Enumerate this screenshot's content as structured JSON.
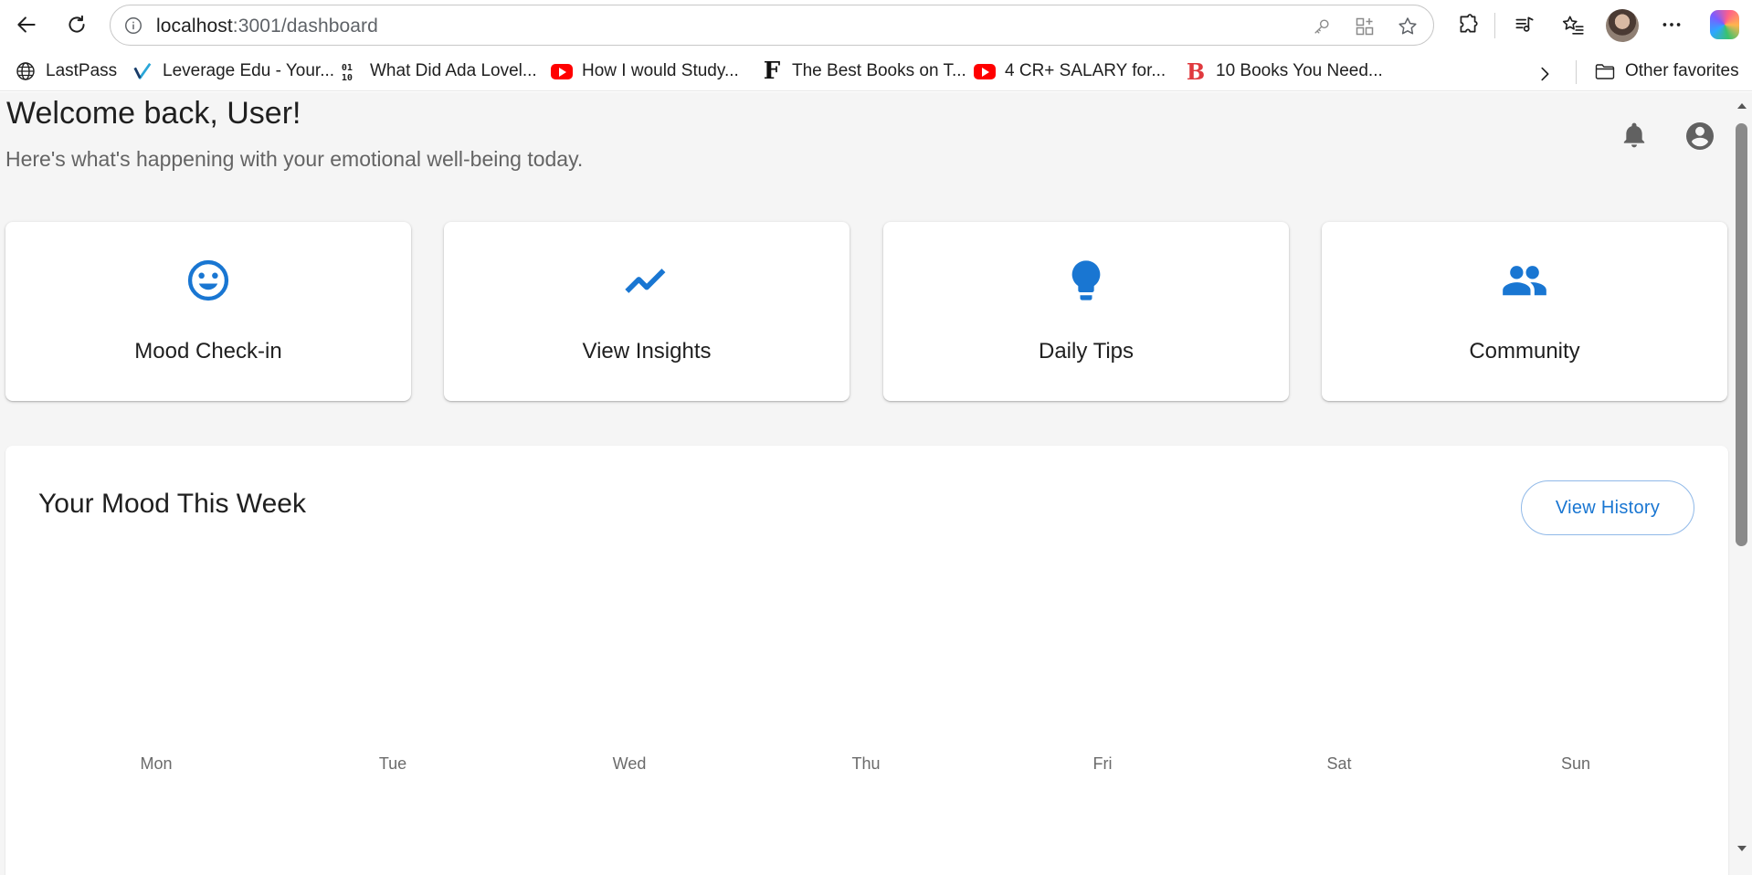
{
  "browser": {
    "url_host": "localhost",
    "url_path": ":3001/dashboard",
    "bookmarks": [
      {
        "label": "LastPass",
        "icon": "globe-icon"
      },
      {
        "label": "Leverage Edu - Your...",
        "icon": "leverage-edu-icon"
      },
      {
        "label": "What Did Ada Lovel...",
        "icon": "ada-icon"
      },
      {
        "label": "How I would Study...",
        "icon": "youtube-icon"
      },
      {
        "label": "The Best Books on T...",
        "icon": "f-letter-icon"
      },
      {
        "label": "4 CR+ SALARY for...",
        "icon": "youtube-icon"
      },
      {
        "label": "10 Books You Need...",
        "icon": "b-letter-icon"
      }
    ],
    "other_favorites": "Other favorites"
  },
  "page": {
    "welcome": "Welcome back, User!",
    "subtitle": "Here's what's happening with your emotional well-being today.",
    "cards": [
      {
        "label": "Mood Check-in",
        "icon": "smiley-icon"
      },
      {
        "label": "View Insights",
        "icon": "trending-up-icon"
      },
      {
        "label": "Daily Tips",
        "icon": "lightbulb-icon"
      },
      {
        "label": "Community",
        "icon": "people-icon"
      }
    ],
    "mood": {
      "title": "Your Mood This Week",
      "history_button": "View History",
      "days": [
        "Mon",
        "Tue",
        "Wed",
        "Thu",
        "Fri",
        "Sat",
        "Sun"
      ]
    }
  },
  "colors": {
    "accent": "#1976d2",
    "page_background": "#f5f5f5",
    "card_background": "#ffffff",
    "icon_gray": "#616161"
  }
}
